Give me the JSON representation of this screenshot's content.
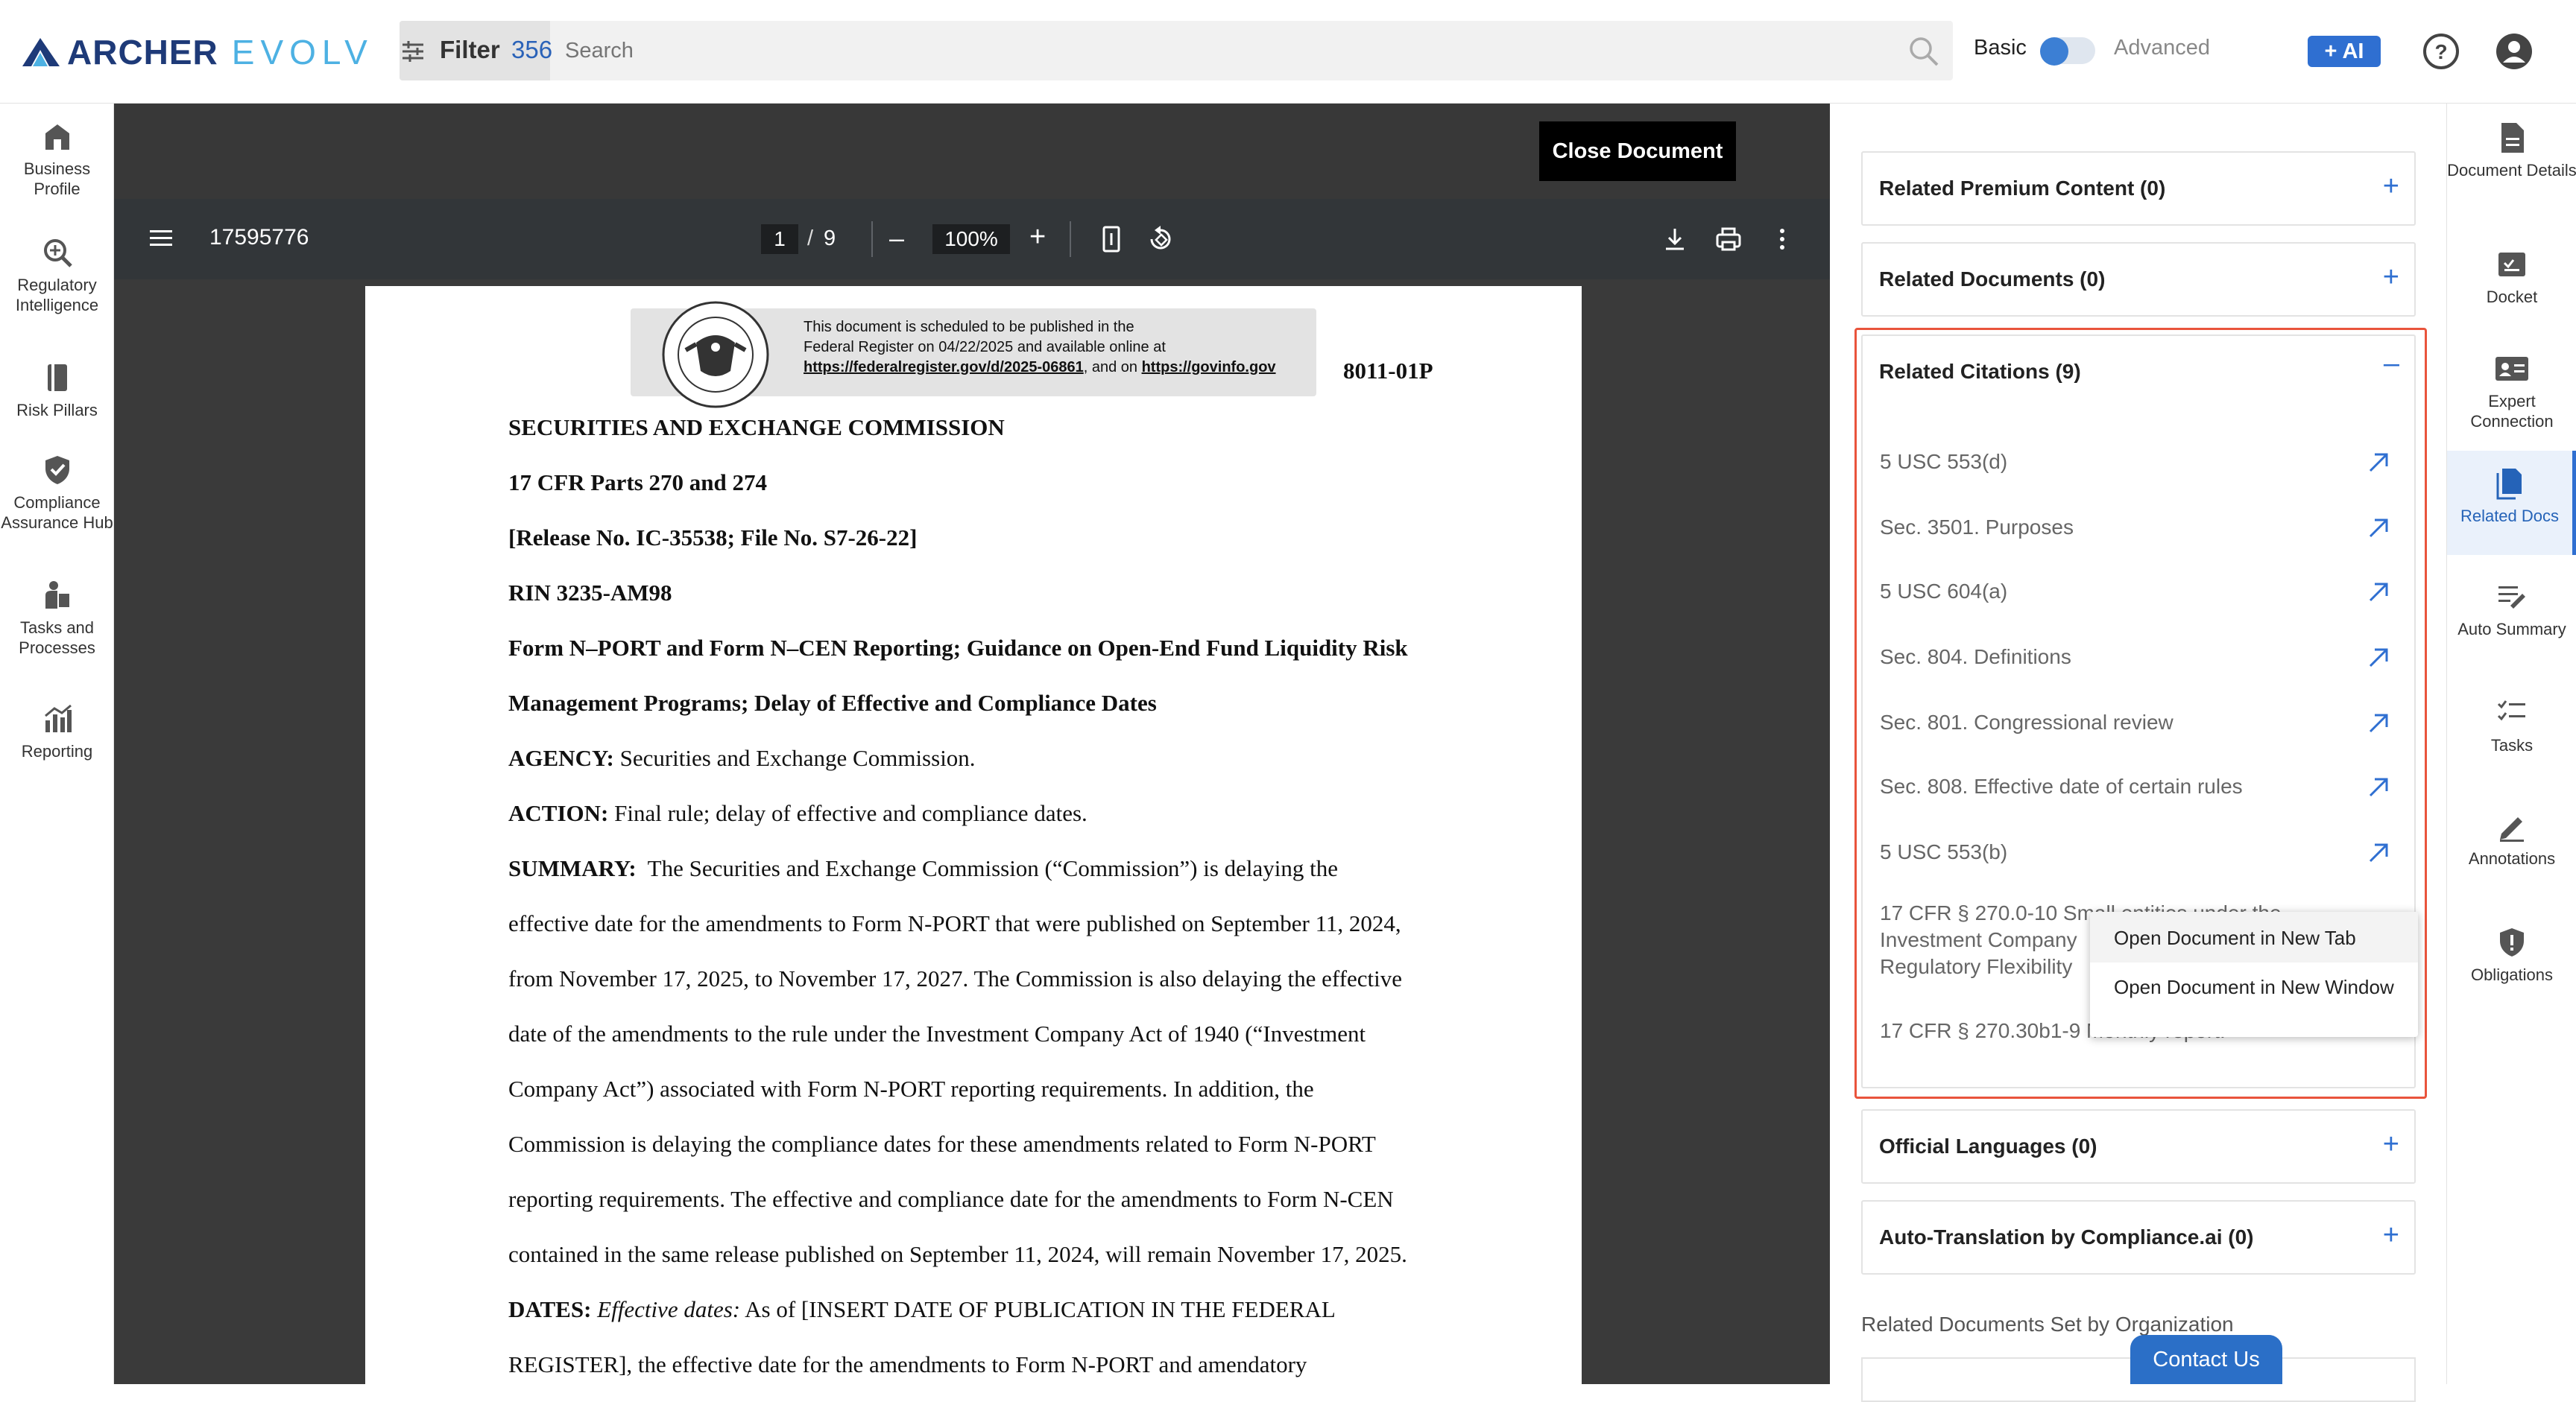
{
  "header": {
    "logo_main": "ARCHER",
    "logo_sub": "EVOLV",
    "filter_label": "Filter",
    "filter_count": "356",
    "search_placeholder": "Search",
    "mode_basic": "Basic",
    "mode_advanced": "Advanced",
    "ai_button": "+ AI"
  },
  "left_nav": [
    {
      "label": "Business Profile",
      "icon": "building-icon"
    },
    {
      "label": "Regulatory Intelligence",
      "icon": "search-plus-icon"
    },
    {
      "label": "Risk Pillars",
      "icon": "book-icon"
    },
    {
      "label": "Compliance Assurance Hub",
      "icon": "shield-check-icon"
    },
    {
      "label": "Tasks and Processes",
      "icon": "tasks-icon"
    },
    {
      "label": "Reporting",
      "icon": "chart-icon"
    }
  ],
  "viewer": {
    "close_button": "Close Document",
    "file_name": "17595776",
    "page_current": "1",
    "page_sep": "/",
    "page_total": "9",
    "zoom": "100%"
  },
  "document": {
    "stamp_line1": "This document is scheduled to be published in the",
    "stamp_line2": "Federal Register on 04/22/2025 and available online at",
    "stamp_link1": "https://federalregister.gov/d/2025-06861",
    "stamp_mid": ", and on ",
    "stamp_link2": "https://govinfo.gov",
    "doc_number": "8011-01P",
    "agency_title": "SECURITIES AND EXCHANGE COMMISSION",
    "cfr_parts": "17 CFR Parts 270 and 274",
    "release": "[Release No. IC-35538; File No. S7-26-22]",
    "rin": "RIN 3235-AM98",
    "title_line1": "Form N–PORT and Form N–CEN Reporting; Guidance on Open-End Fund Liquidity Risk",
    "title_line2": "Management Programs; Delay of Effective and Compliance Dates",
    "agency_label": "AGENCY:",
    "agency_text": " Securities and Exchange Commission.",
    "action_label": "ACTION:",
    "action_text": " Final rule; delay of effective and compliance dates.",
    "summary_label": "SUMMARY:",
    "summary_line1": "  The Securities and Exchange Commission (“Commission”) is delaying the",
    "summary_line2": "effective date for the amendments to Form N-PORT that were published on September 11, 2024,",
    "summary_line3": "from November 17, 2025, to November 17, 2027. The Commission is also delaying the effective",
    "summary_line4": "date of the amendments to the rule under the Investment Company Act of 1940 (“Investment",
    "summary_line5": "Company Act”) associated with Form N-PORT reporting requirements. In addition, the",
    "summary_line6": "Commission is delaying the compliance dates for these amendments related to Form N-PORT",
    "summary_line7": "reporting requirements. The effective and compliance date for the amendments to Form N-CEN",
    "summary_line8": "contained in the same release published on September 11, 2024, will remain November 17, 2025.",
    "dates_label": "DATES:",
    "dates_italic": " Effective dates:",
    "dates_text": " As of [INSERT DATE OF PUBLICATION IN THE FEDERAL",
    "dates_line2": "REGISTER], the effective date for the amendments to Form N-PORT and amendatory"
  },
  "related": {
    "premium": "Related Premium Content (0)",
    "documents": "Related Documents (0)",
    "citations_title": "Related Citations (9)",
    "citations": [
      "5 USC 553(d)",
      "Sec. 3501. Purposes",
      "5 USC 604(a)",
      "Sec. 804. Definitions",
      "Sec. 801. Congressional review",
      "Sec. 808. Effective date of certain rules",
      "5 USC 553(b)"
    ],
    "citation_long_1": "17 CFR § 270.0-10 Small entities under the",
    "citation_long_2": "Investment Company",
    "citation_long_3": "Regulatory Flexibility",
    "citation_last": "17 CFR § 270.30b1-9 Monthly report.",
    "official_languages": "Official Languages (0)",
    "auto_translation": "Auto-Translation by Compliance.ai (0)",
    "set_by_org": "Related Documents Set by Organization"
  },
  "context_menu": {
    "new_tab": "Open Document in New Tab",
    "new_window": "Open Document in New Window"
  },
  "contact_us": "Contact Us",
  "right_nav": [
    {
      "label": "Document Details",
      "icon": "document-icon"
    },
    {
      "label": "Docket",
      "icon": "docket-icon"
    },
    {
      "label": "Expert Connection",
      "icon": "id-card-icon"
    },
    {
      "label": "Related Docs",
      "icon": "files-icon"
    },
    {
      "label": "Auto Summary",
      "icon": "summary-icon"
    },
    {
      "label": "Tasks",
      "icon": "checklist-icon"
    },
    {
      "label": "Annotations",
      "icon": "pen-icon"
    },
    {
      "label": "Obligations",
      "icon": "shield-alert-icon"
    }
  ],
  "colors": {
    "accent": "#2f6fd1",
    "highlight_border": "#e9543c",
    "logo_dark": "#1e3a78",
    "logo_light": "#4db1e3"
  }
}
